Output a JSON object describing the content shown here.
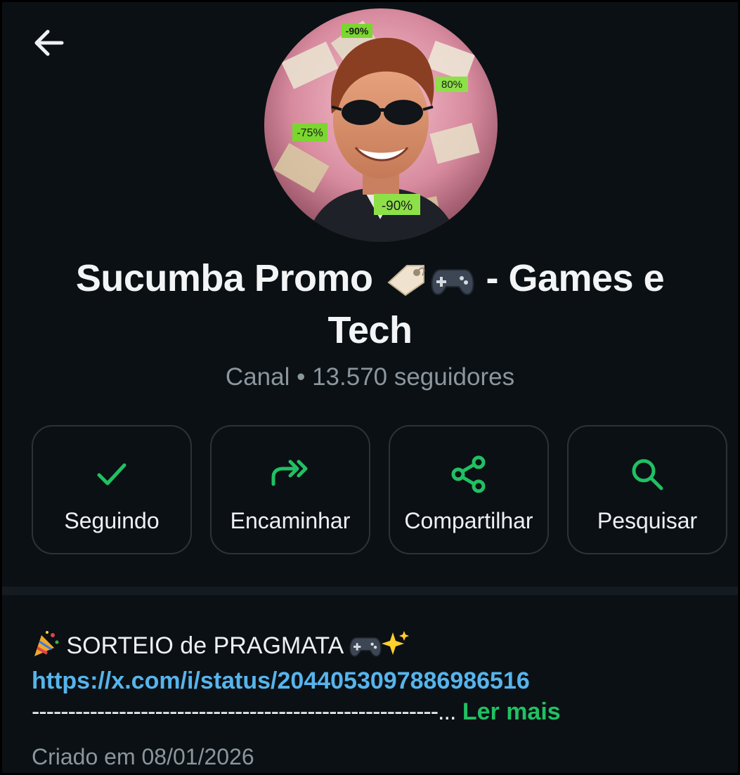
{
  "header": {
    "back_icon": "arrow-left-icon"
  },
  "channel": {
    "name_part1": "Sucumba Promo",
    "name_emojis": [
      "label-tag-emoji",
      "game-controller-emoji"
    ],
    "name_part2": "- Games e Tech",
    "subtitle": "Canal • 13.570 seguidores",
    "avatar_labels": [
      "-90%",
      "80%",
      "-75%",
      "-90%"
    ]
  },
  "actions": [
    {
      "label": "Seguindo",
      "icon": "check-icon"
    },
    {
      "label": "Encaminhar",
      "icon": "forward-icon"
    },
    {
      "label": "Compartilhar",
      "icon": "share-icon"
    },
    {
      "label": "Pesquisar",
      "icon": "search-icon"
    }
  ],
  "post": {
    "title_text": "SORTEIO de PRAGMATA",
    "title_emojis": [
      "party-popper-emoji",
      "game-controller-emoji",
      "sparkles-emoji"
    ],
    "link": "https://x.com/i/status/2044053097886986516",
    "dashes": "--------------------------------------------------------...",
    "read_more": "Ler mais"
  },
  "created": "Criado em 08/01/2026",
  "colors": {
    "background": "#0b1014",
    "accent_green": "#21c063",
    "link_blue": "#56b4ec",
    "muted_text": "#8b969d",
    "button_border": "#2b3339"
  }
}
